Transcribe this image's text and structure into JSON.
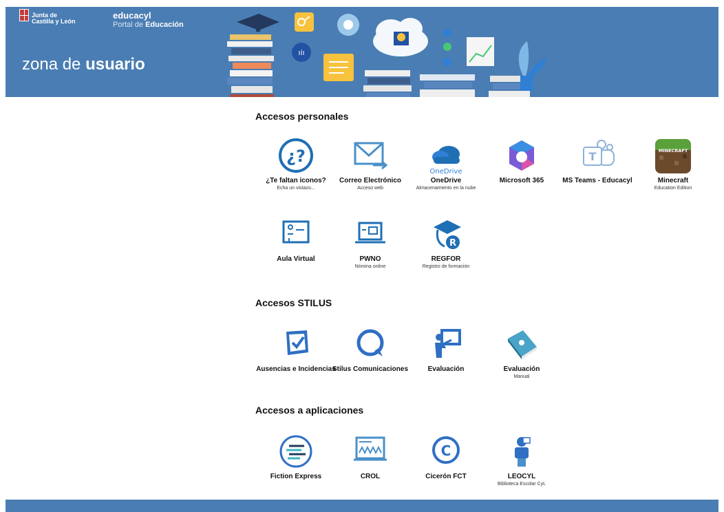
{
  "header": {
    "jcyl_line1": "Junta de",
    "jcyl_line2": "Castilla y León",
    "brand": "educacyl",
    "portal_prefix": "Portal de ",
    "portal_bold": "Educación",
    "zona_prefix": "zona de ",
    "zona_bold": "usuario"
  },
  "sections": {
    "personal": {
      "title": "Accesos personales",
      "items": [
        {
          "label": "¿Te faltan iconos?",
          "sub": "Echa un vistazo..."
        },
        {
          "label": "Correo Electrónico",
          "sub": "Acceso web"
        },
        {
          "label": "OneDrive",
          "sub": "Almacenamiento en la nube",
          "logo_text": "OneDrive"
        },
        {
          "label": "Microsoft 365",
          "sub": ""
        },
        {
          "label": "MS Teams - Educacyl",
          "sub": ""
        },
        {
          "label": "Minecraft",
          "sub": "Education Edition",
          "logo_text": "MINECRAFT"
        },
        {
          "label": "Aula Virtual",
          "sub": ""
        },
        {
          "label": "PWNO",
          "sub": "Nómina online"
        },
        {
          "label": "REGFOR",
          "sub": "Registro de formación"
        }
      ]
    },
    "stilus": {
      "title": "Accesos STILUS",
      "items": [
        {
          "label": "Ausencias e Incidencias",
          "sub": ""
        },
        {
          "label": "Stilus Comunicaciones",
          "sub": ""
        },
        {
          "label": "Evaluación",
          "sub": ""
        },
        {
          "label": "Evaluación",
          "sub": "Manual"
        }
      ]
    },
    "apps": {
      "title": "Accesos a aplicaciones",
      "items": [
        {
          "label": "Fiction Express",
          "sub": ""
        },
        {
          "label": "CROL",
          "sub": ""
        },
        {
          "label": "Cicerón FCT",
          "sub": ""
        },
        {
          "label": "LEOCYL",
          "sub": "Biblioteca Escolar CyL"
        }
      ]
    }
  },
  "colors": {
    "header_blue": "#4a7db3",
    "icon_blue": "#1f6fb5",
    "accent_yellow": "#f7c23d"
  }
}
